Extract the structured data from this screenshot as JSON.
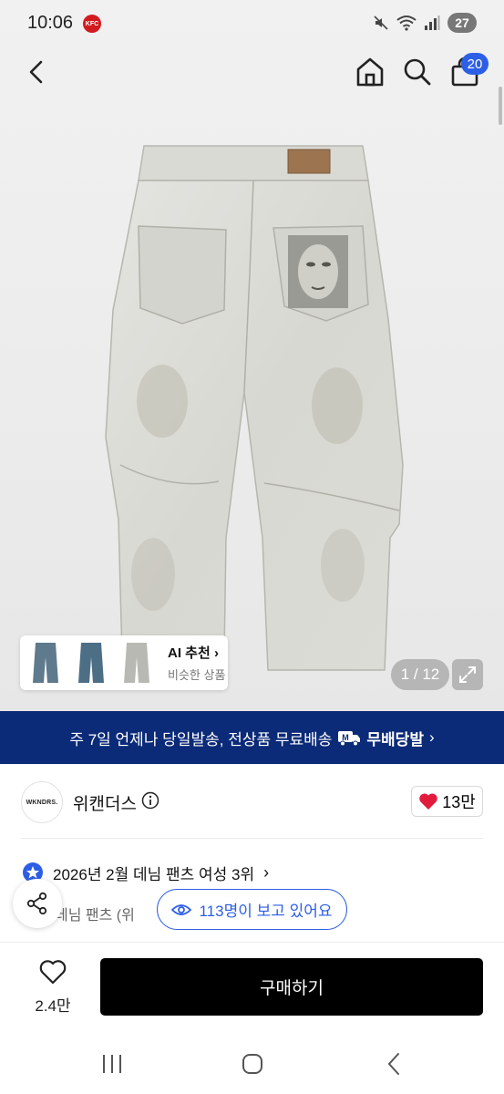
{
  "status_bar": {
    "time": "10:06",
    "notification_app": "KFC",
    "battery": "27"
  },
  "nav": {
    "cart_count": "20"
  },
  "gallery": {
    "ai_title": "AI 추천",
    "ai_sub": "비슷한 상품",
    "counter": "1 / 12"
  },
  "banner": {
    "text": "주 7일 언제나 당일발송, 전상품 무료배송",
    "brand": "무배당발"
  },
  "brand": {
    "logo_text": "WKNDRS.",
    "name": "위캔더스",
    "likes": "13만"
  },
  "ranking": {
    "text": "2026년 2월 데님 팬츠 여성 3위"
  },
  "category": {
    "text": "데님 팬츠 (위"
  },
  "viewers": {
    "text": "113명이 보고 있어요"
  },
  "bottom": {
    "wish_count": "2.4만",
    "buy_label": "구매하기"
  },
  "colors": {
    "accent_blue": "#2d5fe6",
    "banner_navy": "#0b2a78",
    "heart_red": "#e21b3c"
  }
}
